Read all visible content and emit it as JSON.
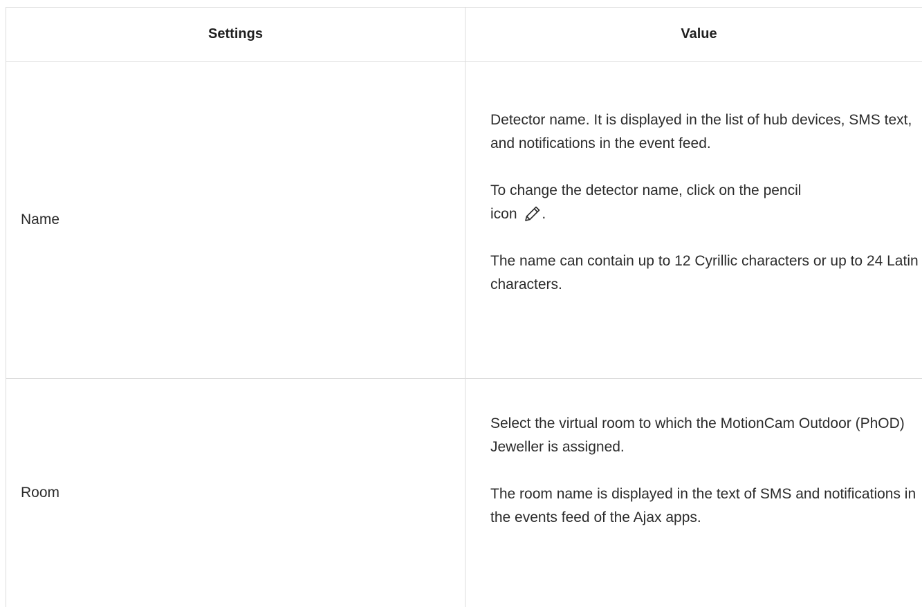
{
  "table": {
    "headers": {
      "settings": "Settings",
      "value": "Value"
    },
    "rows": [
      {
        "setting": "Name",
        "paragraphs": [
          "Detector name. It is displayed in the list of hub devices, SMS text, and notifications in the event feed.",
          "To change the detector name, click on the pencil",
          "The name can contain up to 12 Cyrillic characters or up to 24 Latin characters."
        ],
        "icon_prefix": "icon",
        "icon_suffix": ".",
        "icon": "pencil-icon"
      },
      {
        "setting": "Room",
        "paragraphs": [
          "Select the virtual room to which the MotionCam Outdoor (PhOD) Jeweller is assigned.",
          "The room name is displayed in the text of SMS and notifications in the events feed of the Ajax apps."
        ]
      }
    ]
  }
}
